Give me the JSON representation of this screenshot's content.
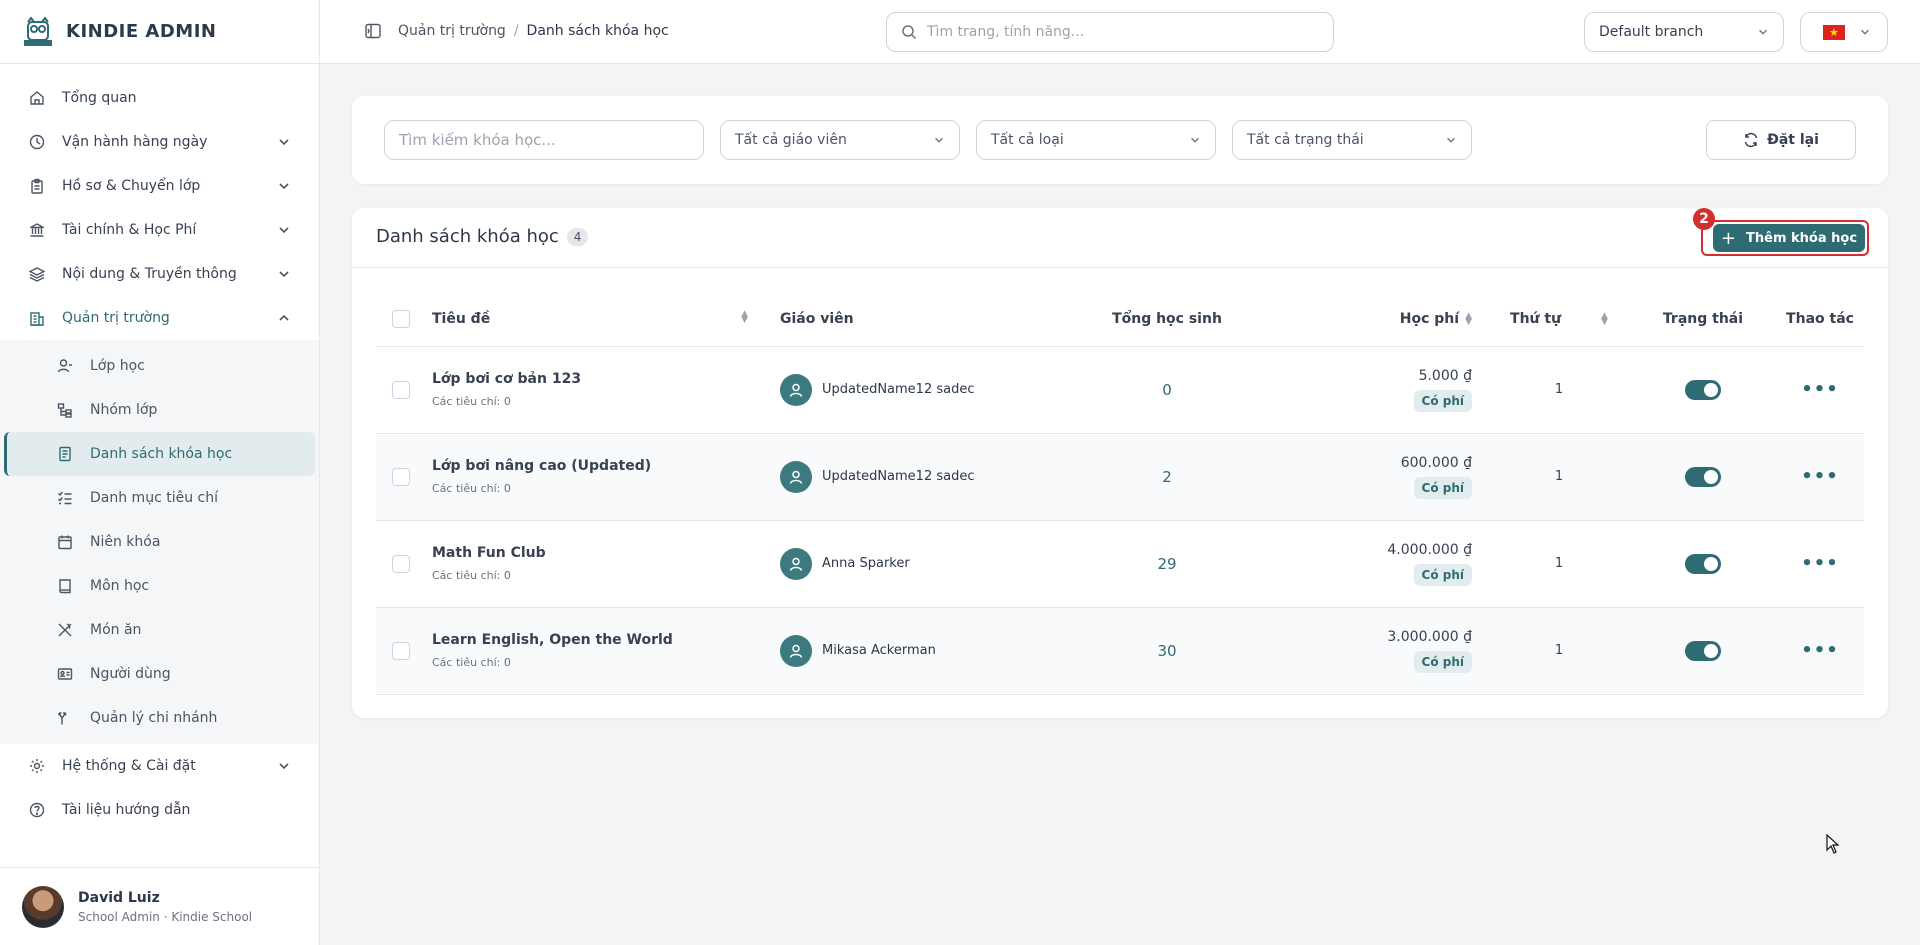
{
  "brand": {
    "name": "KINDIE ADMIN"
  },
  "sidebar": {
    "items": [
      {
        "label": "Tổng quan",
        "icon": "home-icon"
      },
      {
        "label": "Vận hành hàng ngày",
        "icon": "clock-icon"
      },
      {
        "label": "Hồ sơ & Chuyển lớp",
        "icon": "clipboard-icon"
      },
      {
        "label": "Tài chính & Học Phí",
        "icon": "bank-icon"
      },
      {
        "label": "Nội dung & Truyền thông",
        "icon": "layers-icon"
      },
      {
        "label": "Quản trị trường",
        "icon": "building-icon"
      }
    ],
    "sub_items": [
      {
        "label": "Lớp học",
        "icon": "user-icon"
      },
      {
        "label": "Nhóm lớp",
        "icon": "group-icon"
      },
      {
        "label": "Danh sách khóa học",
        "icon": "book-list-icon"
      },
      {
        "label": "Danh mục tiêu chí",
        "icon": "checklist-icon"
      },
      {
        "label": "Niên khóa",
        "icon": "calendar-icon"
      },
      {
        "label": "Môn học",
        "icon": "book-icon"
      },
      {
        "label": "Món ăn",
        "icon": "utensils-icon"
      },
      {
        "label": "Người dùng",
        "icon": "id-card-icon"
      },
      {
        "label": "Quản lý chi nhánh",
        "icon": "branch-icon"
      }
    ],
    "bottom_items": [
      {
        "label": "Hệ thống & Cài đặt",
        "icon": "gear-icon"
      },
      {
        "label": "Tài liệu hướng dẫn",
        "icon": "help-icon"
      }
    ],
    "user": {
      "name": "David Luiz",
      "role": "School Admin · Kindie School"
    }
  },
  "topbar": {
    "breadcrumb": [
      "Quản trị trường",
      "Danh sách khóa học"
    ],
    "search_placeholder": "Tìm trang, tính năng...",
    "branch": "Default branch"
  },
  "filters": {
    "search_placeholder": "Tìm kiếm khóa học...",
    "teacher": "Tất cả giáo viên",
    "type": "Tất cả loại",
    "status": "Tất cả trạng thái",
    "reset_label": "Đặt lại"
  },
  "list": {
    "title": "Danh sách khóa học",
    "count": "4",
    "add_label": "Thêm khóa học",
    "step": "2",
    "columns": [
      "Tiêu đề",
      "Giáo viên",
      "Tổng học sinh",
      "Học phí",
      "Thứ tự",
      "Trạng thái",
      "Thao tác"
    ],
    "rows": [
      {
        "title": "Lớp bơi cơ bản 123",
        "criteria": "Các tiêu chí: 0",
        "teacher": "UpdatedName12 sadec",
        "students": "0",
        "fee": "5.000 ₫",
        "fee_type": "Có phí",
        "order": "1",
        "active": true
      },
      {
        "title": "Lớp bơi nâng cao (Updated)",
        "criteria": "Các tiêu chí: 0",
        "teacher": "UpdatedName12 sadec",
        "students": "2",
        "fee": "600.000 ₫",
        "fee_type": "Có phí",
        "order": "1",
        "active": true
      },
      {
        "title": "Math Fun Club",
        "criteria": "Các tiêu chí: 0",
        "teacher": "Anna Sparker",
        "students": "29",
        "fee": "4.000.000 ₫",
        "fee_type": "Có phí",
        "order": "1",
        "active": true
      },
      {
        "title": "Learn English, Open the World",
        "criteria": "Các tiêu chí: 0",
        "teacher": "Mikasa Ackerman",
        "students": "30",
        "fee": "3.000.000 ₫",
        "fee_type": "Có phí",
        "order": "1",
        "active": true
      }
    ]
  },
  "colors": {
    "accent": "#2f6b72",
    "highlight": "#d32f2f"
  }
}
